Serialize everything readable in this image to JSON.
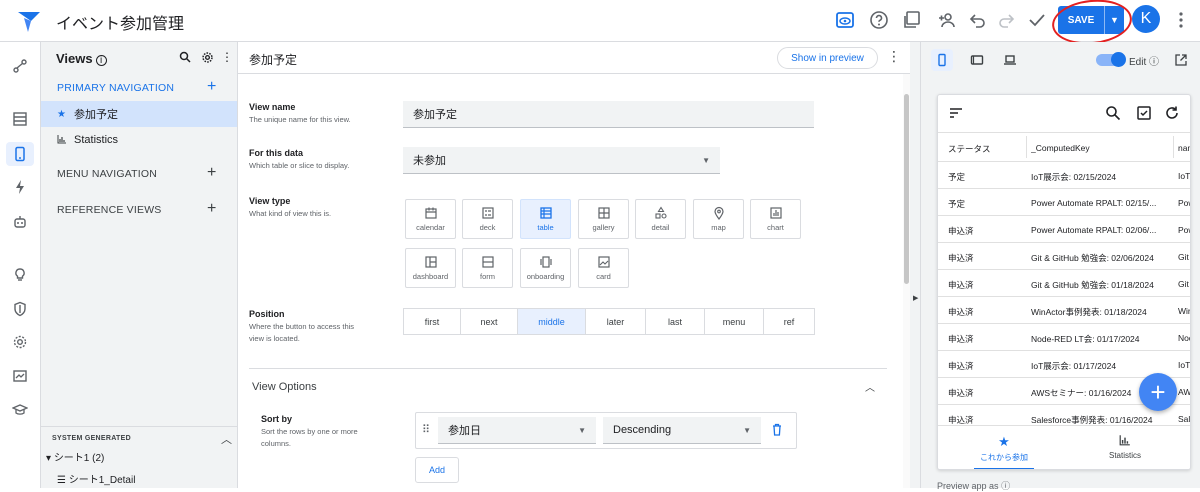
{
  "app": {
    "title": "イベント参加管理"
  },
  "topbar": {
    "save_label": "SAVE",
    "avatar_letter": "K"
  },
  "sidebar": {
    "title": "Views",
    "primary_nav": "PRIMARY NAVIGATION",
    "items": [
      {
        "label": "参加予定"
      },
      {
        "label": "Statistics"
      }
    ],
    "menu_nav": "MENU NAVIGATION",
    "reference_views": "REFERENCE VIEWS",
    "system_generated": "SYSTEM GENERATED",
    "tree_sheet": "シート1 (2)",
    "tree_detail": "シート1_Detail"
  },
  "main": {
    "title": "参加予定",
    "preview_button": "Show in preview",
    "view_name": {
      "label": "View name",
      "desc": "The unique name for this view.",
      "value": "参加予定"
    },
    "for_data": {
      "label": "For this data",
      "desc": "Which table or slice to display.",
      "value": "未参加"
    },
    "view_type": {
      "label": "View type",
      "desc": "What kind of view this is.",
      "types": [
        "calendar",
        "deck",
        "table",
        "gallery",
        "detail",
        "map",
        "chart",
        "dashboard",
        "form",
        "onboarding",
        "card"
      ],
      "selected": "table"
    },
    "position": {
      "label": "Position",
      "desc1": "Where the button to access this",
      "desc2": "view is located.",
      "options": [
        "first",
        "next",
        "middle",
        "later",
        "last",
        "menu",
        "ref"
      ],
      "selected": "middle"
    },
    "view_options": "View Options",
    "sort_by": {
      "label": "Sort by",
      "desc1": "Sort the rows by one or more",
      "desc2": "columns.",
      "column": "参加日",
      "order": "Descending"
    },
    "add_label": "Add"
  },
  "preview": {
    "edit_label": "Edit",
    "columns": [
      "ステータス",
      "_ComputedKey",
      "nam"
    ],
    "rows": [
      [
        "予定",
        "IoT展示会: 02/15/2024",
        "IoT"
      ],
      [
        "予定",
        "Power Automate RPALT: 02/15/...",
        "Pow"
      ],
      [
        "申込済",
        "Power Automate RPALT: 02/06/...",
        "Pow"
      ],
      [
        "申込済",
        "Git & GitHub 勉強会: 02/06/2024",
        "Git"
      ],
      [
        "申込済",
        "Git & GitHub 勉強会: 01/18/2024",
        "Git"
      ],
      [
        "申込済",
        "WinActor事例発表: 01/18/2024",
        "Win"
      ],
      [
        "申込済",
        "Node-RED LT会: 01/17/2024",
        "Nod"
      ],
      [
        "申込済",
        "IoT展示会: 01/17/2024",
        "IoT"
      ],
      [
        "申込済",
        "AWSセミナー: 01/16/2024",
        "AW"
      ],
      [
        "申込済",
        "Salesforce事例発表: 01/16/2024",
        "Sal"
      ]
    ],
    "bottom_nav": [
      {
        "label": "これから参加"
      },
      {
        "label": "Statistics"
      }
    ],
    "footer": "Preview app as"
  }
}
